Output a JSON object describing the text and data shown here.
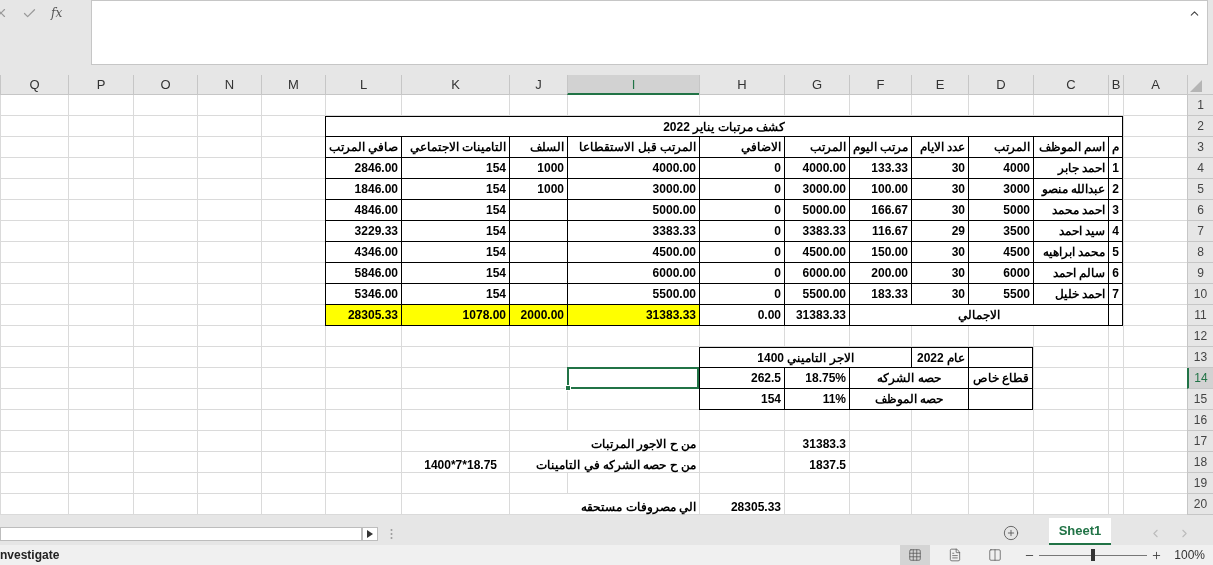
{
  "formula_bar": {
    "function_label": "fx"
  },
  "column_headers": [
    {
      "label": "A",
      "selected": false
    },
    {
      "label": "B",
      "selected": false
    },
    {
      "label": "C",
      "selected": false
    },
    {
      "label": "D",
      "selected": false
    },
    {
      "label": "E",
      "selected": false
    },
    {
      "label": "F",
      "selected": false
    },
    {
      "label": "G",
      "selected": false
    },
    {
      "label": "H",
      "selected": false
    },
    {
      "label": "I",
      "selected": true
    },
    {
      "label": "J",
      "selected": false
    },
    {
      "label": "K",
      "selected": false
    },
    {
      "label": "L",
      "selected": false
    },
    {
      "label": "M",
      "selected": false
    },
    {
      "label": "N",
      "selected": false
    },
    {
      "label": "O",
      "selected": false
    },
    {
      "label": "P",
      "selected": false
    },
    {
      "label": "Q",
      "selected": false
    }
  ],
  "row_headers": [
    {
      "label": "1",
      "selected": false
    },
    {
      "label": "2",
      "selected": false
    },
    {
      "label": "3",
      "selected": false
    },
    {
      "label": "4",
      "selected": false
    },
    {
      "label": "5",
      "selected": false
    },
    {
      "label": "6",
      "selected": false
    },
    {
      "label": "7",
      "selected": false
    },
    {
      "label": "8",
      "selected": false
    },
    {
      "label": "9",
      "selected": false
    },
    {
      "label": "10",
      "selected": false
    },
    {
      "label": "11",
      "selected": false
    },
    {
      "label": "12",
      "selected": false
    },
    {
      "label": "13",
      "selected": false
    },
    {
      "label": "14",
      "selected": true
    },
    {
      "label": "15",
      "selected": false
    },
    {
      "label": "16",
      "selected": false
    },
    {
      "label": "17",
      "selected": false
    },
    {
      "label": "18",
      "selected": false
    },
    {
      "label": "19",
      "selected": false
    },
    {
      "label": "20",
      "selected": false
    }
  ],
  "payroll": {
    "title": "كشف مرتبات يناير 2022",
    "columns": [
      "م",
      "اسم الموظف",
      "المرتب",
      "عدد الايام",
      "مرتب اليوم",
      "المرتب",
      "الاضافي",
      "المرتب قبل الاستقطاعا",
      "السلف",
      "التامينات الاجتماعي",
      "صافي المرتب"
    ],
    "rows": [
      {
        "no": "1",
        "name": "احمد جابر",
        "salary": "4000",
        "days": "30",
        "daily": "133.33",
        "earned": "4000.00",
        "extra": "0",
        "gross": "4000.00",
        "advance": "1000",
        "insurance": "154",
        "net": "2846.00"
      },
      {
        "no": "2",
        "name": "عبدالله منصو",
        "salary": "3000",
        "days": "30",
        "daily": "100.00",
        "earned": "3000.00",
        "extra": "0",
        "gross": "3000.00",
        "advance": "1000",
        "insurance": "154",
        "net": "1846.00"
      },
      {
        "no": "3",
        "name": "احمد محمد",
        "salary": "5000",
        "days": "30",
        "daily": "166.67",
        "earned": "5000.00",
        "extra": "0",
        "gross": "5000.00",
        "insurance": "154",
        "net": "4846.00"
      },
      {
        "no": "4",
        "name": "سيد احمد",
        "salary": "3500",
        "days": "29",
        "daily": "116.67",
        "earned": "3383.33",
        "extra": "0",
        "gross": "3383.33",
        "insurance": "154",
        "net": "3229.33"
      },
      {
        "no": "5",
        "name": "محمد ابراهيه",
        "salary": "4500",
        "days": "30",
        "daily": "150.00",
        "earned": "4500.00",
        "extra": "0",
        "gross": "4500.00",
        "insurance": "154",
        "net": "4346.00"
      },
      {
        "no": "6",
        "name": "سالم احمد",
        "salary": "6000",
        "days": "30",
        "daily": "200.00",
        "earned": "6000.00",
        "extra": "0",
        "gross": "6000.00",
        "insurance": "154",
        "net": "5846.00"
      },
      {
        "no": "7",
        "name": "احمد خليل",
        "salary": "5500",
        "days": "30",
        "daily": "183.33",
        "earned": "5500.00",
        "extra": "0",
        "gross": "5500.00",
        "insurance": "154",
        "net": "5346.00"
      }
    ],
    "total_label": "الاجمالي",
    "totals": [
      {
        "text": "31383.33",
        "highlighted": false
      },
      {
        "text": "0.00",
        "highlighted": false
      },
      {
        "text": "31383.33",
        "highlighted": true
      },
      {
        "text": "2000.00",
        "highlighted": true
      },
      {
        "text": "1078.00",
        "highlighted": true
      },
      {
        "text": "28305.33",
        "highlighted": true
      }
    ]
  },
  "insurance": {
    "year_label": "عام 2022",
    "base_label": "الاجر التاميني 1400",
    "sector": "قطاع خاص",
    "shares": [
      {
        "label": "حصه الشركه",
        "rate": "18.75%",
        "amount": "262.5"
      },
      {
        "label": "حصه الموظف",
        "rate": "11%",
        "amount": "154"
      }
    ]
  },
  "journal": [
    {
      "text": "من ح الاجور المرتبات",
      "debit_amount": "31383.3"
    },
    {
      "text": "من ح حصه الشركه في التامينات",
      "debit_amount": "1837.5",
      "note": "1400*7*18.75"
    },
    {
      "text": "الي مصروفات مستحقه",
      "credit_amount": "28305.33"
    }
  ],
  "sheet_tabs": [
    {
      "label": "Sheet1",
      "selected": true
    }
  ],
  "status_bar": {
    "text": "nvestigate",
    "views": [
      {
        "kind": "normal",
        "selected": true
      },
      {
        "kind": "page_layout",
        "selected": false
      },
      {
        "kind": "page_break",
        "selected": false
      }
    ],
    "zoom_slider": {
      "level": 0.5
    },
    "zoom": "100%"
  }
}
